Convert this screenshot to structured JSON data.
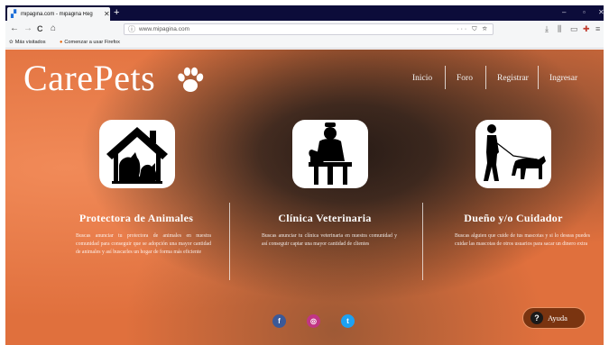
{
  "browser": {
    "tab": {
      "title": "mipagina.com - mipagina Reg",
      "favicon": "favicon-icon",
      "close": "✕"
    },
    "new_tab": "+",
    "window_controls": {
      "minimize": "–",
      "maximize": "▫",
      "close": "✕"
    },
    "nav": {
      "back": "←",
      "forward": "→",
      "reload": "C",
      "home": "⌂"
    },
    "url": "www.mipagina.com",
    "url_tools": "··· ⛉ ☆",
    "bookmarks": [
      {
        "label": "Más visitados",
        "icon": "gear-icon"
      },
      {
        "label": "Comenzar a usar Firefox",
        "icon": "firefox-icon"
      }
    ],
    "right_icons": [
      "download-icon",
      "library-icon",
      "sidebar-icon",
      "extension-icon",
      "menu-icon"
    ]
  },
  "site": {
    "logo": "CarePets",
    "nav": [
      "Inicio",
      "Foro",
      "Registrar",
      "Ingresar"
    ],
    "cards": [
      {
        "title": "Protectora de Animales",
        "icon": "shelter-house-icon",
        "description": "Buscas anunciar tu protectora de animales en nuestra comunidad para conseguir que se adopción una mayor cantidad de animales y así buscarles un hogar de forma más eficiente"
      },
      {
        "title": "Clínica Veterinaria",
        "icon": "veterinarian-icon",
        "description": "Buscas anunciar tu clínica veterinaria en nuestra comunidad y así conseguir captar una mayor cantidad de clientes"
      },
      {
        "title": "Dueño y/o Cuidador",
        "icon": "dog-walker-icon",
        "description": "Buscas alguien que cuide de tus mascotas y si lo deseas puedes cuidar las mascotas de otros usuarios para sacar un dinero extra"
      }
    ],
    "social": [
      {
        "name": "facebook",
        "glyph": "f",
        "color": "#3b5998"
      },
      {
        "name": "instagram",
        "glyph": "◎",
        "color": "#c13584"
      },
      {
        "name": "twitter",
        "glyph": "t",
        "color": "#1da1f2"
      }
    ],
    "help_label": "Ayuda",
    "help_glyph": "?"
  }
}
